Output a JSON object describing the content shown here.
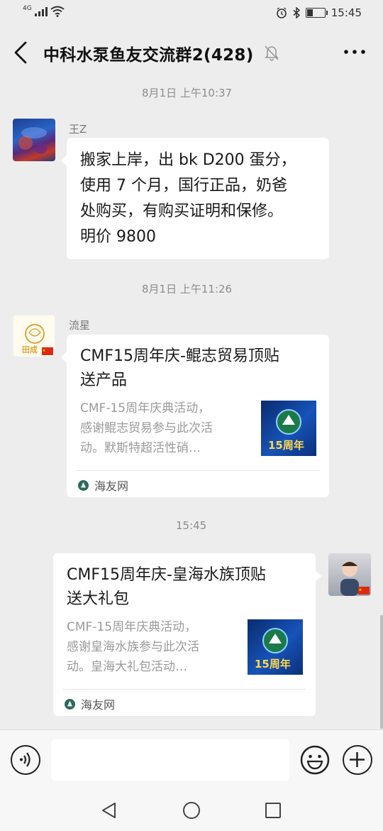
{
  "status_bar": {
    "network": "4G",
    "time": "15:45",
    "icons": [
      "signal-icon",
      "wifi-icon",
      "alarm-icon",
      "bluetooth-icon",
      "battery-icon"
    ]
  },
  "header": {
    "title": "中科水泵鱼友交流群2(428)",
    "back_icon": "back-icon",
    "mute_icon": "mute-bell-icon",
    "more_icon": "more-icon"
  },
  "messages": [
    {
      "timestamp": "8月1日 上午10:37",
      "sender": "王Z",
      "type": "text",
      "lines": [
        "搬家上岸，出 bk   D200 蛋分，",
        "使用 7 个月，国行正品，奶爸",
        "处购买，有购买证明和保修。",
        "明价 9800"
      ]
    },
    {
      "timestamp": "8月1日 上午11:26",
      "sender": "流星",
      "avatar_text": "田成",
      "type": "card",
      "title_lines": [
        "CMF15周年庆-鲲志贸易顶贴",
        "送产品"
      ],
      "desc_lines": [
        "CMF-15周年庆典活动，",
        "感谢鲲志贸易参与此次活",
        "动。默斯特超活性硝…"
      ],
      "thumb_text": "15周年",
      "source": "海友网"
    },
    {
      "timestamp": "15:45",
      "sender": "",
      "type": "card",
      "title_lines": [
        "CMF15周年庆-皇海水族顶贴",
        "送大礼包"
      ],
      "desc_lines": [
        "CMF-15周年庆典活动，",
        "感谢皇海水族参与此次活",
        "动。皇海大礼包活动…"
      ],
      "thumb_text": "15周年",
      "source": "海友网"
    }
  ],
  "input_bar": {
    "placeholder": "",
    "icons": [
      "voice-icon",
      "emoji-icon",
      "plus-icon"
    ]
  },
  "nav_bar": {
    "icons": [
      "back-triangle-icon",
      "home-circle-icon",
      "recents-square-icon"
    ]
  },
  "colors": {
    "background": "#ededed",
    "bubble": "#ffffff",
    "card_thumb": "#1753b8"
  }
}
